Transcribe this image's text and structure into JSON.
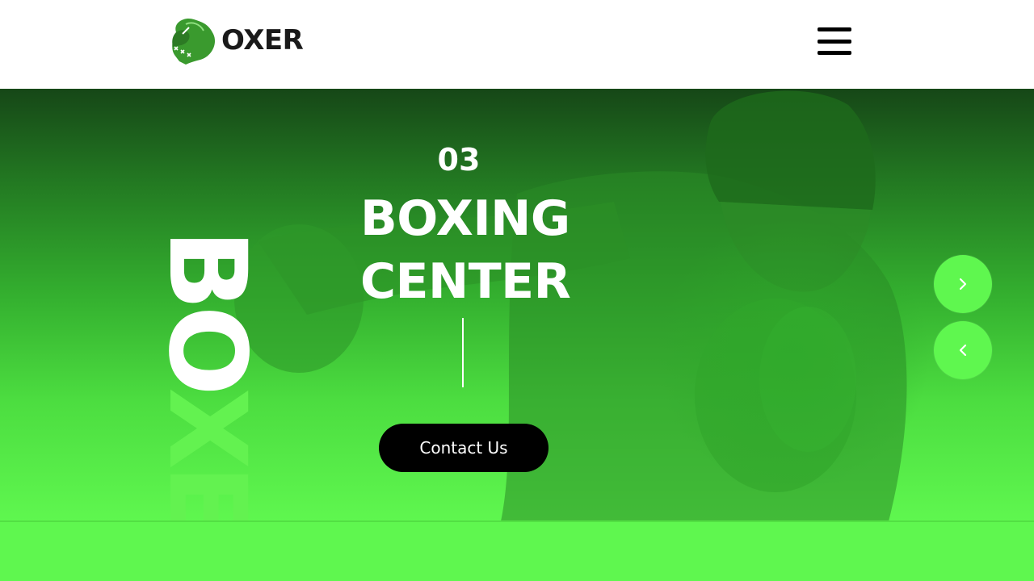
{
  "header": {
    "logo_text": "OXER",
    "logo_icon": "boxing-glove-icon",
    "menu_icon": "hamburger-menu-icon"
  },
  "hero": {
    "vertical_word_part1": "BO",
    "vertical_word_part2": "XER",
    "slide_number": "03",
    "title_line1": "BOXING",
    "title_line2": "CENTER",
    "cta_label": "Contact Us",
    "next_icon": "chevron-right-icon",
    "prev_icon": "chevron-left-icon"
  },
  "colors": {
    "accent": "#5ff74f",
    "header_bg": "#ffffff",
    "button_bg": "#000000",
    "dark_green": "#164717"
  }
}
